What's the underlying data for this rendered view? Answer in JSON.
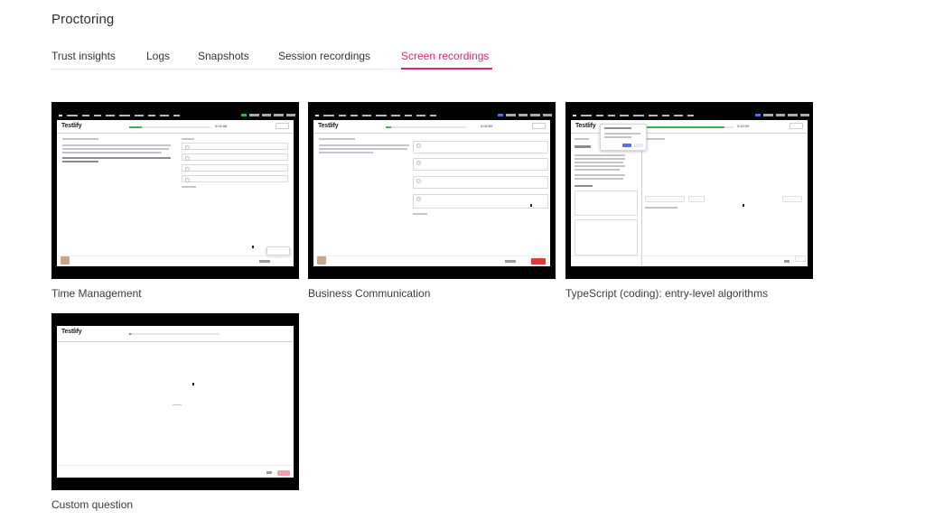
{
  "page": {
    "title": "Proctoring"
  },
  "tabs": [
    {
      "label": "Trust insights",
      "active": false
    },
    {
      "label": "Logs",
      "active": false
    },
    {
      "label": "Snapshots",
      "active": false
    },
    {
      "label": "Session recordings",
      "active": false
    },
    {
      "label": "Screen recordings",
      "active": true
    }
  ],
  "accent_color": "#e0245e",
  "recordings": [
    {
      "caption": "Time Management",
      "timer": "0:04:56"
    },
    {
      "caption": "Business Communication",
      "timer": "0:04:59"
    },
    {
      "caption": "TypeScript (coding): entry-level algorithms",
      "timer": "0:10:00"
    },
    {
      "caption": "Custom question"
    }
  ],
  "app": {
    "logo": "Testlify"
  }
}
